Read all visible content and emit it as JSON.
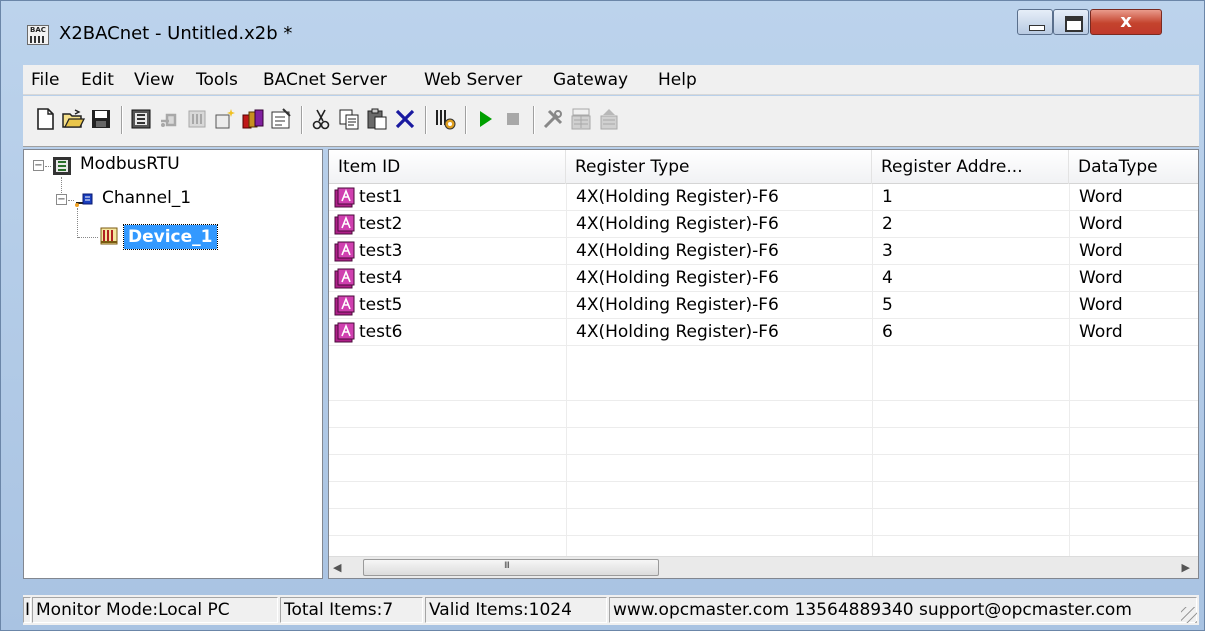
{
  "window": {
    "title": "X2BACnet - Untitled.x2b *",
    "app_icon_text": "BAC",
    "close_label": "x"
  },
  "menu": [
    "File",
    "Edit",
    "View",
    "Tools",
    "BACnet Server",
    "Web Server",
    "Gateway",
    "Help"
  ],
  "toolbar": {
    "buttons": [
      "new-file-icon",
      "open-folder-icon",
      "save-icon",
      "add-channel-icon",
      "add-device-icon-disabled",
      "add-item-icon-disabled",
      "new-item-icon",
      "batch-items-icon",
      "properties-icon",
      "cut-icon",
      "copy-icon",
      "paste-icon",
      "delete-icon",
      "find-icon",
      "run-icon",
      "stop-icon",
      "tools-icon",
      "load-icon-disabled",
      "up-icon-disabled"
    ],
    "colors": {
      "run": "#00a000",
      "delete": "#1a1aa0",
      "disabled": "#a8a8a8"
    }
  },
  "tree": {
    "root": "ModbusRTU",
    "channel": "Channel_1",
    "device": "Device_1",
    "expander_minus": "−"
  },
  "list": {
    "columns": [
      "Item ID",
      "Register Type",
      "Register Addre...",
      "DataType"
    ],
    "rows": [
      {
        "id": "test1",
        "type": "4X(Holding Register)-F6",
        "addr": "1",
        "dtype": "Word"
      },
      {
        "id": "test2",
        "type": "4X(Holding Register)-F6",
        "addr": "2",
        "dtype": "Word"
      },
      {
        "id": "test3",
        "type": "4X(Holding Register)-F6",
        "addr": "3",
        "dtype": "Word"
      },
      {
        "id": "test4",
        "type": "4X(Holding Register)-F6",
        "addr": "4",
        "dtype": "Word"
      },
      {
        "id": "test5",
        "type": "4X(Holding Register)-F6",
        "addr": "5",
        "dtype": "Word"
      },
      {
        "id": "test6",
        "type": "4X(Holding Register)-F6",
        "addr": "6",
        "dtype": "Word"
      }
    ],
    "scroll": {
      "left": "◀",
      "right": "▶",
      "grip": "III"
    }
  },
  "status": {
    "pane0": "I",
    "monitor": "Monitor Mode:Local PC",
    "total": "Total Items:7",
    "valid": "Valid Items:1024",
    "contact": "www.opcmaster.com 13564889340 support@opcmaster.com"
  }
}
